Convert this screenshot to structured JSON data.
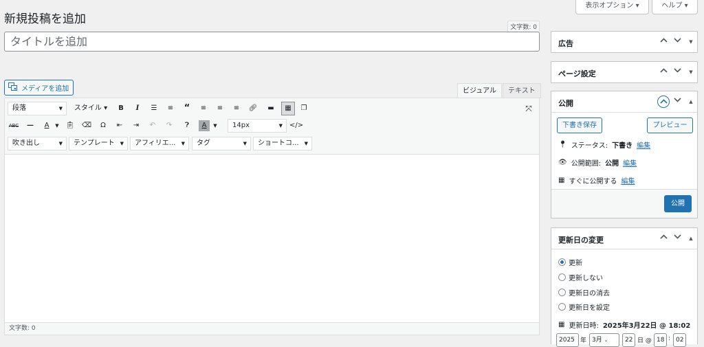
{
  "header": {
    "title": "新規投稿を追加",
    "screen_options": "表示オプション ▾",
    "help": "ヘルプ ▾"
  },
  "title_field": {
    "char_count": "文字数: 0",
    "placeholder": "タイトルを追加"
  },
  "editor": {
    "add_media": "メディアを追加",
    "tab_visual": "ビジュアル",
    "tab_text": "テキスト",
    "format_select": "段落",
    "style_select": "スタイル ▾",
    "font_size": "14px",
    "row3": [
      "吹き出し",
      "テンプレート",
      "アフィリエ...",
      "タグ",
      "ショートコ..."
    ],
    "status_count": "文字数: 0"
  },
  "sidebar": {
    "ad_box": "広告",
    "page_settings_box": "ページ設定",
    "publish_box": {
      "title": "公開",
      "save_draft": "下書き保存",
      "preview": "プレビュー",
      "status_label": "ステータス:",
      "status_value": "下書き",
      "visibility_label": "公開範囲:",
      "visibility_value": "公開",
      "schedule_label": "すぐに公開する",
      "edit": "編集",
      "publish_button": "公開"
    },
    "modified_box": {
      "title": "更新日の変更",
      "options": [
        "更新",
        "更新しない",
        "更新日の消去",
        "更新日を設定"
      ],
      "selected_index": 0,
      "modified_label": "更新日時:",
      "modified_value": "2025年3月22日 @ 18:02",
      "year": "2025",
      "year_unit": "年",
      "month": "3月",
      "day": "22",
      "day_unit": "日 @",
      "hour": "18",
      "colon": ":",
      "minute": "02"
    }
  },
  "colors": {
    "accent": "#2271b1",
    "background": "#f0f0f1"
  }
}
